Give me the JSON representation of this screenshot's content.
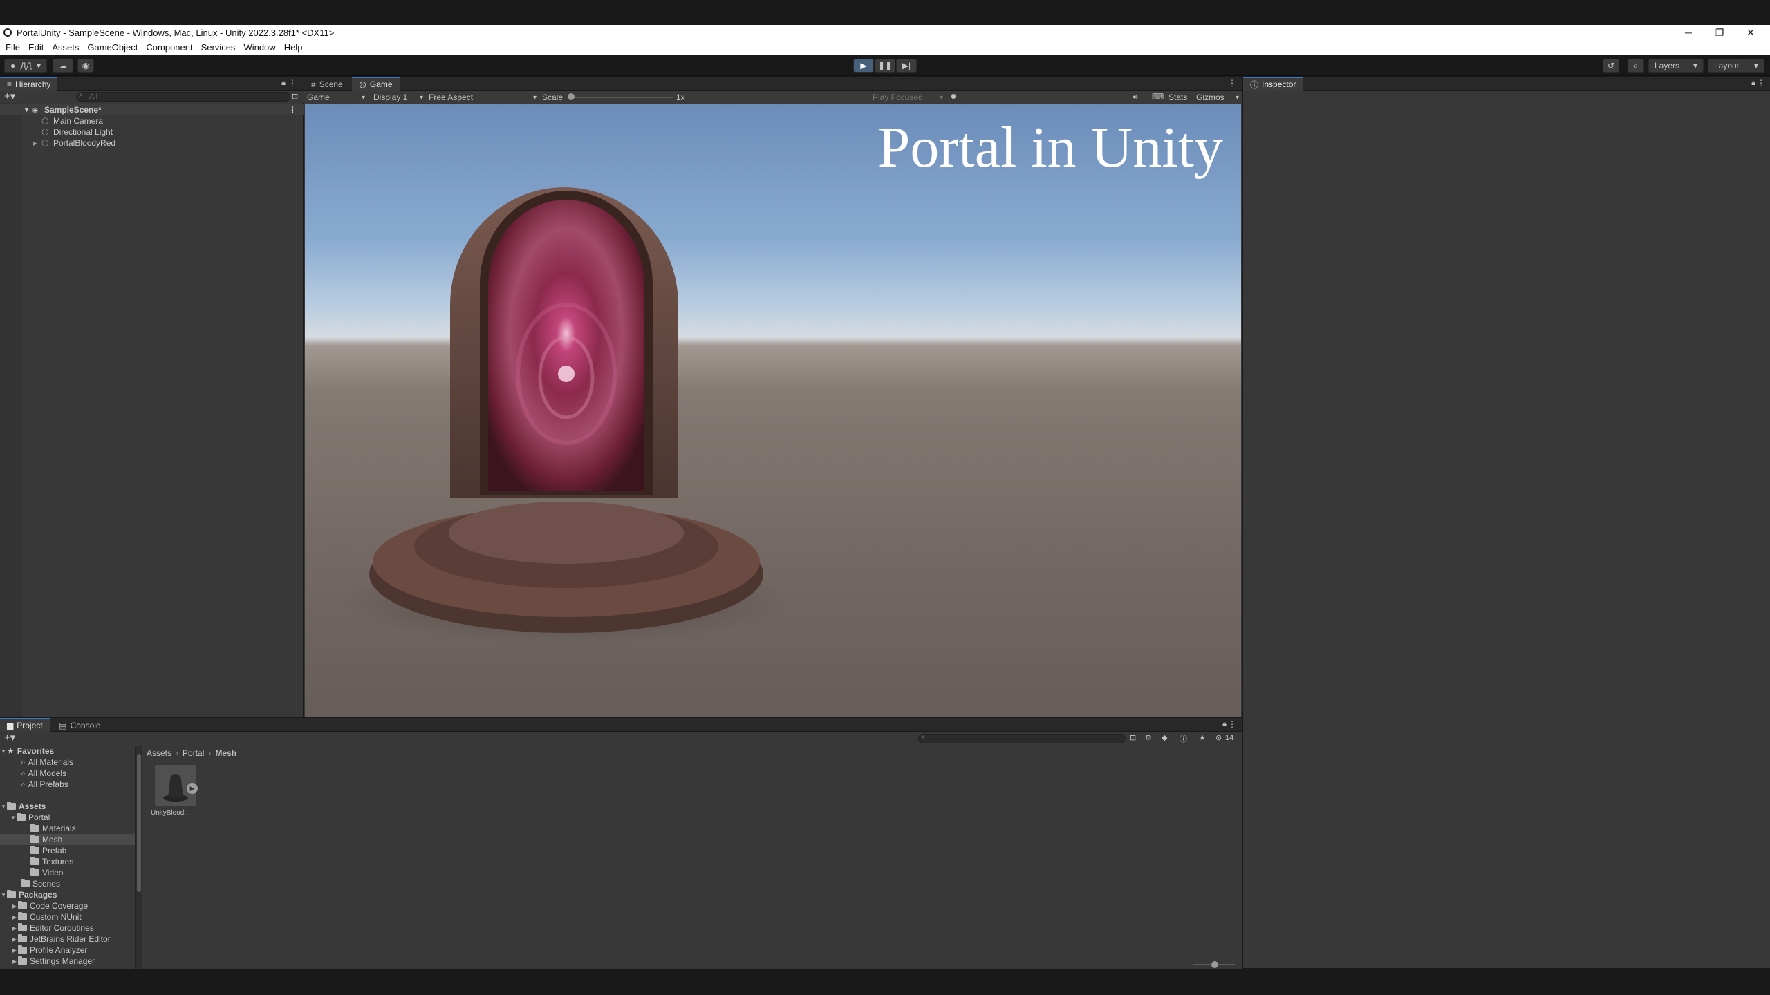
{
  "window": {
    "title": "PortalUnity - SampleScene - Windows, Mac, Linux - Unity 2022.3.28f1* <DX11>",
    "controls": {
      "minimize": "─",
      "maximize": "❐",
      "close": "✕"
    }
  },
  "menu": [
    "File",
    "Edit",
    "Assets",
    "GameObject",
    "Component",
    "Services",
    "Window",
    "Help"
  ],
  "toolbar": {
    "account_label": "ДД",
    "layers_label": "Layers",
    "layout_label": "Layout",
    "play_state": "playing"
  },
  "hierarchy": {
    "tab": "Hierarchy",
    "search_placeholder": "All",
    "scene": "SampleScene*",
    "items": [
      "Main Camera",
      "Directional Light",
      "PortalBloodyRed"
    ]
  },
  "game_view": {
    "tabs": [
      "Scene",
      "Game"
    ],
    "active_tab": "Game",
    "view_mode": "Game",
    "display": "Display 1",
    "aspect": "Free Aspect",
    "scale_label": "Scale",
    "scale_value": "1x",
    "play_focused": "Play Focused",
    "stats": "Stats",
    "gizmos": "Gizmos",
    "overlay_text": "Portal in Unity"
  },
  "inspector": {
    "tab": "Inspector"
  },
  "project": {
    "tabs": [
      "Project",
      "Console"
    ],
    "favorites_label": "Favorites",
    "favorites": [
      "All Materials",
      "All Models",
      "All Prefabs"
    ],
    "assets_label": "Assets",
    "portal_label": "Portal",
    "portal_children": [
      "Materials",
      "Mesh",
      "Prefab",
      "Textures",
      "Video"
    ],
    "selected_folder": "Mesh",
    "scenes_label": "Scenes",
    "packages_label": "Packages",
    "packages": [
      "Code Coverage",
      "Custom NUnit",
      "Editor Coroutines",
      "JetBrains Rider Editor",
      "Profile Analyzer",
      "Settings Manager"
    ],
    "breadcrumb": [
      "Assets",
      "Portal",
      "Mesh"
    ],
    "breadcrumb_sep": "›",
    "asset_name": "UnityBlood...",
    "hidden_count": "14"
  }
}
